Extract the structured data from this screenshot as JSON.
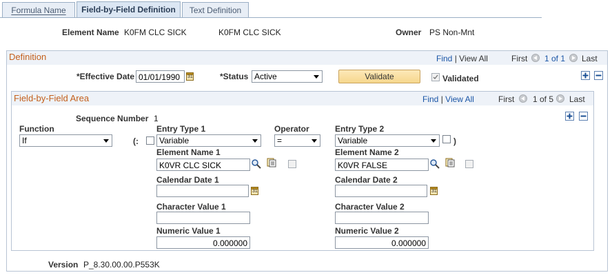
{
  "tabs": [
    {
      "label": "Formula Name",
      "active": false
    },
    {
      "label": "Field-by-Field Definition",
      "active": true
    },
    {
      "label": "Text Definition",
      "active": false
    }
  ],
  "header": {
    "element_name_label": "Element Name",
    "element_name_value": "K0FM CLC SICK",
    "element_description": "K0FM CLC SICK",
    "owner_label": "Owner",
    "owner_value": "PS Non-Mnt"
  },
  "definition": {
    "title": "Definition",
    "find": "Find",
    "view_all": "View All",
    "first": "First",
    "count": "1 of 1",
    "last": "Last",
    "effective_date_label": "*Effective Date",
    "effective_date_value": "01/01/1990",
    "status_label": "*Status",
    "status_value": "Active",
    "validate_button": "Validate",
    "validated_label": "Validated"
  },
  "fbf": {
    "title": "Field-by-Field Area",
    "find": "Find",
    "view_all": "View All",
    "first": "First",
    "count": "1 of 5",
    "last": "Last",
    "sequence_label": "Sequence Number",
    "sequence_value": "1",
    "function_label": "Function",
    "function_value": "If",
    "open_paren": "(:",
    "close_paren": ")",
    "entry_type1_label": "Entry Type 1",
    "entry_type1_value": "Variable",
    "operator_label": "Operator",
    "operator_value": "=",
    "entry_type2_label": "Entry Type 2",
    "entry_type2_value": "Variable",
    "element_name1_label": "Element Name 1",
    "element_name1_value": "K0VR CLC SICK",
    "element_name2_label": "Element Name 2",
    "element_name2_value": "K0VR FALSE",
    "calendar_date1_label": "Calendar Date 1",
    "calendar_date1_value": "",
    "calendar_date2_label": "Calendar Date 2",
    "calendar_date2_value": "",
    "char_value1_label": "Character Value 1",
    "char_value1_value": "",
    "char_value2_label": "Character Value 2",
    "char_value2_value": "",
    "numeric_value1_label": "Numeric Value 1",
    "numeric_value1_value": "0.000000",
    "numeric_value2_label": "Numeric Value 2",
    "numeric_value2_value": "0.000000"
  },
  "footer": {
    "version_label": "Version",
    "version_value": "P_8.30.00.00.P553K"
  },
  "colors": {
    "section_title": "#c4601c",
    "link": "#1a55a6",
    "validate_button": "#f6d78d"
  },
  "icons": [
    "calendar-icon",
    "search-icon",
    "detail-icon",
    "plus-icon",
    "minus-icon",
    "previous-icon",
    "next-icon",
    "dropdown-arrow-icon",
    "checkbox-icon"
  ]
}
